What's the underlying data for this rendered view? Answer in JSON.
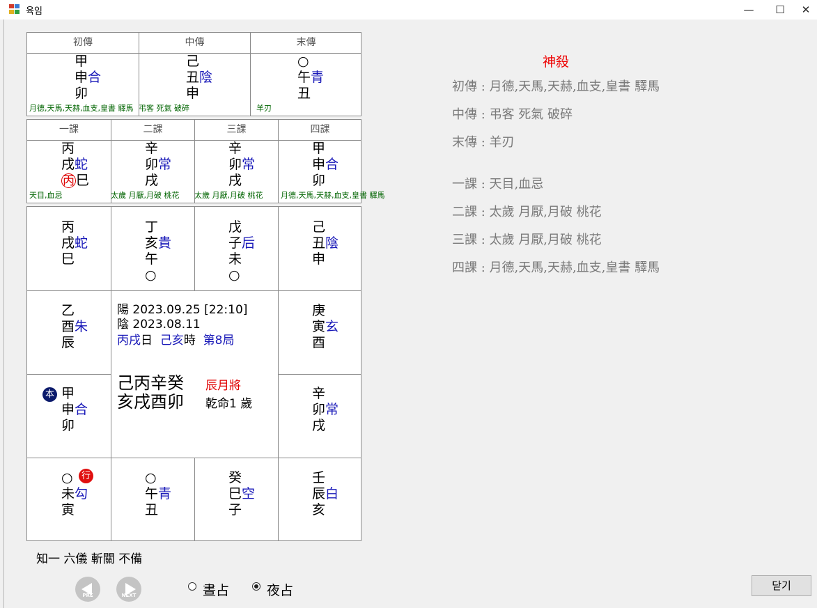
{
  "window": {
    "title": "육임",
    "minimize": "—",
    "maximize": "☐",
    "close": "✕"
  },
  "sanchuan": {
    "headers": [
      "初傳",
      "中傳",
      "末傳"
    ],
    "cells": [
      {
        "l1": "甲",
        "l2": "申",
        "god": "合",
        "l3": "卯"
      },
      {
        "l1": "己",
        "l2": "丑",
        "god": "陰",
        "l3": "申"
      },
      {
        "l1": "○",
        "l2": "午",
        "god": "青",
        "l3": "丑"
      }
    ],
    "shen": [
      "月德,天馬,天赫,血支,皇書 驛馬",
      "弔客 死氣 破碎",
      "羊刃"
    ]
  },
  "sike": {
    "headers": [
      "一課",
      "二課",
      "三課",
      "四課"
    ],
    "cells": [
      {
        "l1": "丙",
        "l2": "戌",
        "god": "蛇",
        "l3a": "丙",
        "l3b": "巳"
      },
      {
        "l1": "辛",
        "l2": "卯",
        "god": "常",
        "l3": "戌"
      },
      {
        "l1": "辛",
        "l2": "卯",
        "god": "常",
        "l3": "戌"
      },
      {
        "l1": "甲",
        "l2": "申",
        "god": "合",
        "l3": "卯"
      }
    ],
    "shen": [
      "天目,血忌",
      "太歲 月厭,月破 桃花",
      "太歲 月厭,月破 桃花",
      "月德,天馬,天赫,血支,皇書 驛馬"
    ]
  },
  "board": {
    "cells": [
      {
        "l1": "丙",
        "l2": "戌",
        "god": "蛇",
        "l3": "巳",
        "l4": ""
      },
      {
        "l1": "丁",
        "l2": "亥",
        "god": "貴",
        "l3": "午",
        "l4": "○"
      },
      {
        "l1": "戊",
        "l2": "子",
        "god": "后",
        "l3": "未",
        "l4": "○"
      },
      {
        "l1": "己",
        "l2": "丑",
        "god": "陰",
        "l3": "申",
        "l4": ""
      },
      {
        "l1": "乙",
        "l2": "酉",
        "god": "朱",
        "l3": "辰",
        "l4": ""
      },
      {
        "l1": "庚",
        "l2": "寅",
        "god": "玄",
        "l3": "酉",
        "l4": ""
      },
      {
        "l1": "甲",
        "l2": "申",
        "god": "合",
        "l3": "卯",
        "l4": ""
      },
      {
        "l1": "辛",
        "l2": "卯",
        "god": "常",
        "l3": "戌",
        "l4": ""
      },
      {
        "l1": "○",
        "l2": "未",
        "god": "勾",
        "l3": "寅",
        "l4": ""
      },
      {
        "l1": "○",
        "l2": "午",
        "god": "青",
        "l3": "丑",
        "l4": ""
      },
      {
        "l1": "癸",
        "l2": "巳",
        "god": "空",
        "l3": "子",
        "l4": ""
      },
      {
        "l1": "壬",
        "l2": "辰",
        "god": "白",
        "l3": "亥",
        "l4": ""
      }
    ],
    "badges": {
      "ben": "本",
      "xing": "行"
    },
    "badge_colors": {
      "ben": "#0b1a6b",
      "xing": "#e01010"
    },
    "center": {
      "solar": "陽  2023.09.25  [22:10]",
      "lunar": "陰  2023.08.11",
      "day_gz": "丙戌",
      "day_suffix": "日",
      "hour_gz": "己亥",
      "hour_suffix": "時",
      "ju": "第8局",
      "pillars_top": "己丙辛癸",
      "pillars_bottom": "亥戌酉卯",
      "yuejiang": "辰月將",
      "ming": "乾命1 歲"
    }
  },
  "summary": "知一 六儀 斬關 不備",
  "shinsal": {
    "title": "神殺",
    "lines": [
      "初傳 :  月德,天馬,天赫,血支,皇書 驛馬",
      "中傳 : 弔客 死氣 破碎",
      "末傳 :     羊刃",
      "一課 :  天目,血忌",
      "二課 : 太歲 月厭,月破 桃花",
      "三課 : 太歲 月厭,月破 桃花",
      "四課 :  月德,天馬,天赫,血支,皇書 驛馬"
    ]
  },
  "nav": {
    "prev": "PRE",
    "next": "NEXT"
  },
  "options": {
    "day": "晝占",
    "night": "夜占",
    "selected": "night"
  },
  "close_label": "닫기",
  "colors": {
    "blue_god": "#1818b8",
    "red": "#e00000",
    "green_shensha": "#006400",
    "gray_text": "#7a7a7a"
  }
}
